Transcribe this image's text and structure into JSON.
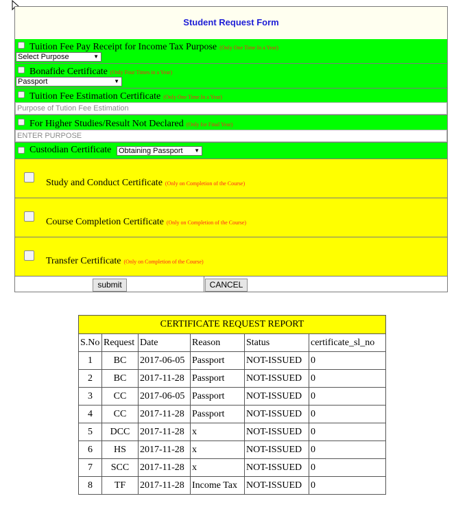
{
  "form": {
    "title": "Student Request Form",
    "items": [
      {
        "label": "Tuition Fee Pay Receipt for Income Tax Purpose",
        "note": "(Only One Time In a Year)",
        "select_value": "Select Purpose"
      },
      {
        "label": "Bonafide Certificate",
        "note": "(Only Four Times in a Year)",
        "select_value": "Passport"
      },
      {
        "label": "Tuition Fee Estimation Certificate",
        "note": "(Only One Time In a Year)",
        "input_placeholder": "Purpose of Tution Fee Estimation"
      },
      {
        "label": "For Higher Studies/Result Not Declared",
        "note": "(Only for Final Year)",
        "input_placeholder": "ENTER PURPOSE"
      },
      {
        "label": "Custodian Certificate",
        "select_value": "Obtaining Passport"
      },
      {
        "label": "Study and Conduct Certificate",
        "note": "(Only on Completion of the Course)"
      },
      {
        "label": "Course Completion Certificate",
        "note": "(Only on Completion of the Course)"
      },
      {
        "label": "Transfer Certificate",
        "note": "(Only on Completion of the Course)"
      }
    ],
    "submit_label": "submit",
    "cancel_label": "CANCEL"
  },
  "report": {
    "title": "CERTIFICATE REQUEST REPORT",
    "columns": [
      "S.No",
      "Request",
      "Date",
      "Reason",
      "Status",
      "certificate_sl_no"
    ],
    "rows": [
      [
        "1",
        "BC",
        "2017-06-05",
        "Passport",
        "NOT-ISSUED",
        "0"
      ],
      [
        "2",
        "BC",
        "2017-11-28",
        "Passport",
        "NOT-ISSUED",
        "0"
      ],
      [
        "3",
        "CC",
        "2017-06-05",
        "Passport",
        "NOT-ISSUED",
        "0"
      ],
      [
        "4",
        "CC",
        "2017-11-28",
        "Passport",
        "NOT-ISSUED",
        "0"
      ],
      [
        "5",
        "DCC",
        "2017-11-28",
        "x",
        "NOT-ISSUED",
        "0"
      ],
      [
        "6",
        "HS",
        "2017-11-28",
        "x",
        "NOT-ISSUED",
        "0"
      ],
      [
        "7",
        "SCC",
        "2017-11-28",
        "x",
        "NOT-ISSUED",
        "0"
      ],
      [
        "8",
        "TF",
        "2017-11-28",
        "Income Tax",
        "NOT-ISSUED",
        "0"
      ]
    ]
  },
  "colors": {
    "green": "#00ff00",
    "yellow": "#ffff00",
    "title_blue": "#1d1dd6",
    "note_red": "#ff2020"
  },
  "icons": {
    "cursor": "mouse-pointer-icon",
    "dropdown": "dropdown-arrow-icon"
  }
}
